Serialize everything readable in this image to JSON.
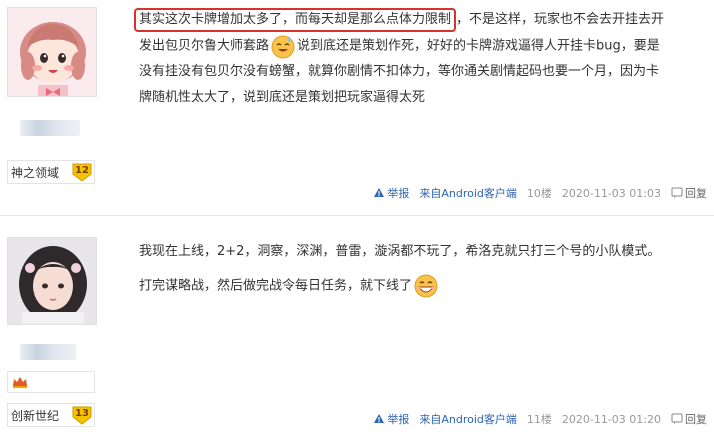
{
  "posts": [
    {
      "level_name": "神之领域",
      "level": "12",
      "content": {
        "highlighted": "其实这次卡牌增加太多了，而每天却是那么点体力限制",
        "line1_rest": "，不是这样，玩家也不会去开挂去开",
        "line2_a": "发出包贝尔鲁大师套路",
        "line2_b": "说到底还是策划作死，好好的卡牌游戏逼得人开挂卡bug，要是",
        "line3": "没有挂没有包贝尔没有螃蟹，就算你剧情不扣体力，等你通关剧情起码也要一个月，因为卡",
        "line4": "牌随机性太大了，说到底还是策划把玩家逼得太死"
      },
      "emoji": "sweat-smile-emoji",
      "tail": {
        "report": "举报",
        "source": "来自Android客户端",
        "floor": "10楼",
        "time": "2020-11-03 01:03",
        "reply": "回复"
      }
    },
    {
      "level_name": "创新世纪",
      "level": "13",
      "content": {
        "line1": "我现在上线，2+2，洞察，深渊，普雷，漩涡都不玩了，希洛克就只打三个号的小队模式。",
        "line2": "打完谋略战，然后做完战令每日任务，就下线了"
      },
      "emoji": "grin-emoji",
      "tail": {
        "report": "举报",
        "source": "来自Android客户端",
        "floor": "11楼",
        "time": "2020-11-03 01:20",
        "reply": "回复"
      }
    }
  ],
  "colors": {
    "highlight_border": "#d9312b",
    "link": "#2d64b3",
    "meta": "#999999",
    "badge": "#f5c400"
  },
  "icons": [
    "cartoon-girl-avatar",
    "photo-girl-avatar",
    "level-badge-icon",
    "report-icon",
    "reply-icon",
    "crown-icon"
  ]
}
